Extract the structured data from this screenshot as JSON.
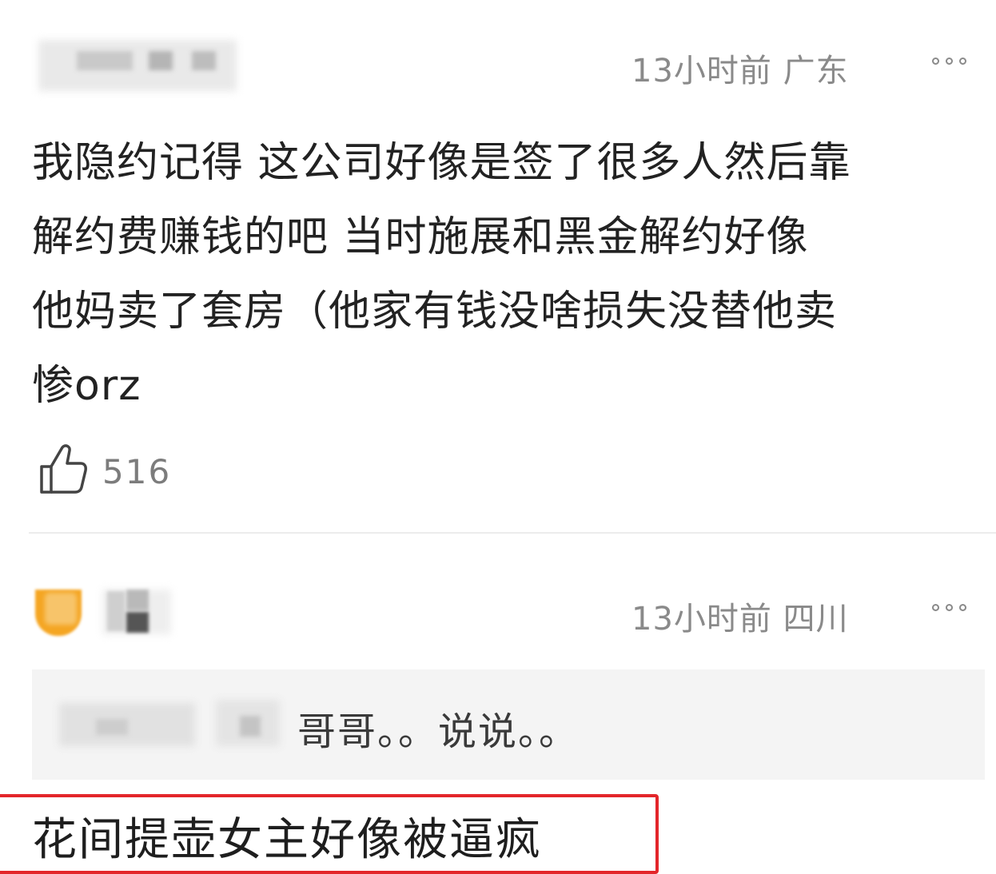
{
  "comment1": {
    "time_location": "13小时前 广东",
    "lines": [
      "我隐约记得 这公司好像是签了很多人然后靠",
      "解约费赚钱的吧  当时施展和黑金解约好像",
      "他妈卖了套房（他家有钱没啥损失没替他卖",
      "惨orz"
    ],
    "like_count": "516"
  },
  "comment2": {
    "time_location": "13小时前 四川",
    "quoted_reply": "哥哥。。说说。。",
    "text": "花间提壶女主好像被逼疯"
  },
  "colors": {
    "highlight_border": "#e3262a",
    "avatar_orange": "#f5a623"
  },
  "icons": {
    "like": "thumbs-up-icon",
    "more": "more-icon"
  }
}
